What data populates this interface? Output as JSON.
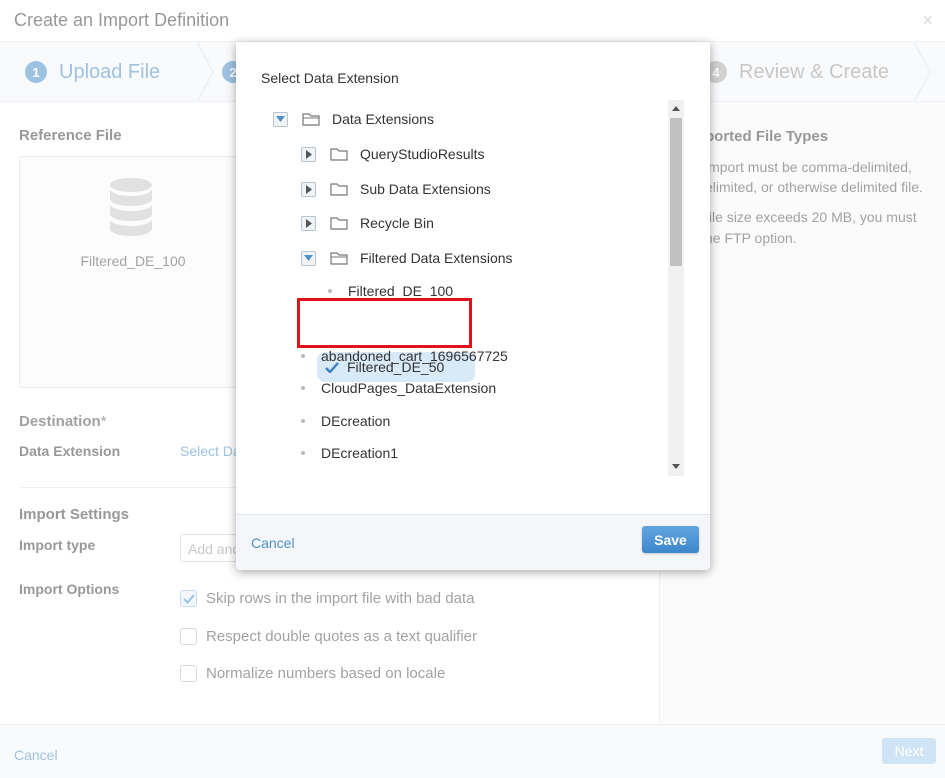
{
  "window": {
    "title": "Create an Import Definition",
    "close_glyph": "×"
  },
  "steps": [
    {
      "number": "1",
      "label": "Upload File"
    },
    {
      "number": "2",
      "label": ""
    },
    {
      "number": "4",
      "label": "Review & Create"
    }
  ],
  "reference": {
    "section_title": "Reference File",
    "file_name": "Filtered_DE_100"
  },
  "destination": {
    "section_title": "Destination",
    "required_mark": "*",
    "data_extension_label": "Data Extension",
    "select_link": "Select Da"
  },
  "import_settings": {
    "section_title": "Import Settings",
    "import_type_label": "Import type",
    "import_type_placeholder": "Add and",
    "options_label": "Import Options",
    "options": [
      {
        "label": "Skip rows in the import file with bad data",
        "checked": true
      },
      {
        "label": "Respect double quotes as a text qualifier",
        "checked": false
      },
      {
        "label": "Normalize numbers based on locale",
        "checked": false
      }
    ]
  },
  "right_panel": {
    "title": "ported File Types",
    "line1": "import must be comma-delimited,",
    "line2": "elimited, or otherwise delimited file.",
    "line3": "file size exceeds 20 MB, you must",
    "line4": "he FTP option."
  },
  "footer": {
    "cancel": "Cancel",
    "next": "Next"
  },
  "modal": {
    "title": "Select Data Extension",
    "tree": {
      "root": "Data Extensions",
      "folders": [
        "QueryStudioResults",
        "Sub Data Extensions",
        "Recycle Bin",
        "Filtered Data Extensions"
      ],
      "filtered_children": [
        "Filtered_DE_100",
        "Filtered_DE_50"
      ],
      "selected": "Filtered_DE_50",
      "root_items": [
        "abandoned_cart_1696567725",
        "CloudPages_DataExtension",
        "DEcreation",
        "DEcreation1"
      ]
    },
    "cancel": "Cancel",
    "save": "Save"
  },
  "colors": {
    "accent": "#4f90c8",
    "highlight": "#e0121a",
    "selection": "#d8e9f7"
  }
}
